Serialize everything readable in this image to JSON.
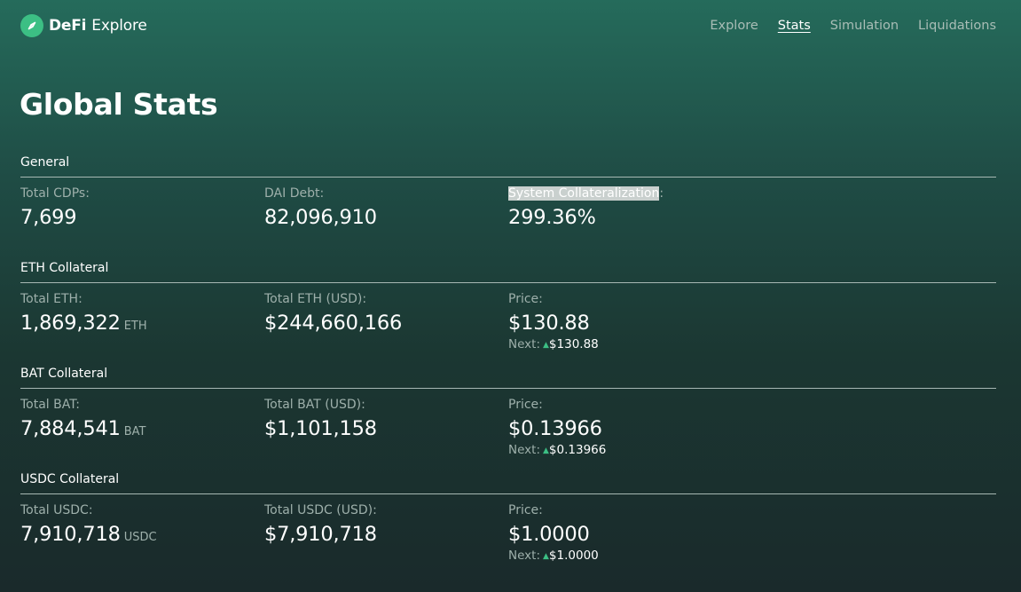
{
  "header": {
    "brand_bold": "DeFi",
    "brand_rest": "Explore",
    "logo_icon": "compass-leaf-icon",
    "nav": [
      {
        "label": "Explore",
        "active": false
      },
      {
        "label": "Stats",
        "active": true
      },
      {
        "label": "Simulation",
        "active": false
      },
      {
        "label": "Liquidations",
        "active": false
      }
    ]
  },
  "page": {
    "title": "Global Stats"
  },
  "colors": {
    "accent": "#3cbf84",
    "bg_top": "#256b5b",
    "bg_bottom": "#1a2a2b",
    "muted_text": "#9eb0ab"
  },
  "sections": {
    "general": {
      "title": "General",
      "total_cdps_label": "Total CDPs:",
      "total_cdps_value": "7,699",
      "dai_debt_label": "DAI Debt:",
      "dai_debt_value": "82,096,910",
      "collateralization_label_highlighted": "System Collateralization",
      "collateralization_label_colon": ":",
      "collateralization_value": "299.36%"
    },
    "eth": {
      "title": "ETH Collateral",
      "total_label": "Total ETH:",
      "total_value": "1,869,322",
      "total_unit": "ETH",
      "usd_label": "Total ETH (USD):",
      "usd_value": "$244,660,166",
      "price_label": "Price:",
      "price_value": "$130.88",
      "next_label": "Next:",
      "next_arrow": "▲",
      "next_value": "$130.88"
    },
    "bat": {
      "title": "BAT Collateral",
      "total_label": "Total BAT:",
      "total_value": "7,884,541",
      "total_unit": "BAT",
      "usd_label": "Total BAT (USD):",
      "usd_value": "$1,101,158",
      "price_label": "Price:",
      "price_value": "$0.13966",
      "next_label": "Next:",
      "next_arrow": "▲",
      "next_value": "$0.13966"
    },
    "usdc": {
      "title": "USDC Collateral",
      "total_label": "Total USDC:",
      "total_value": "7,910,718",
      "total_unit": "USDC",
      "usd_label": "Total USDC (USD):",
      "usd_value": "$7,910,718",
      "price_label": "Price:",
      "price_value": "$1.0000",
      "next_label": "Next:",
      "next_arrow": "▲",
      "next_value": "$1.0000"
    }
  }
}
